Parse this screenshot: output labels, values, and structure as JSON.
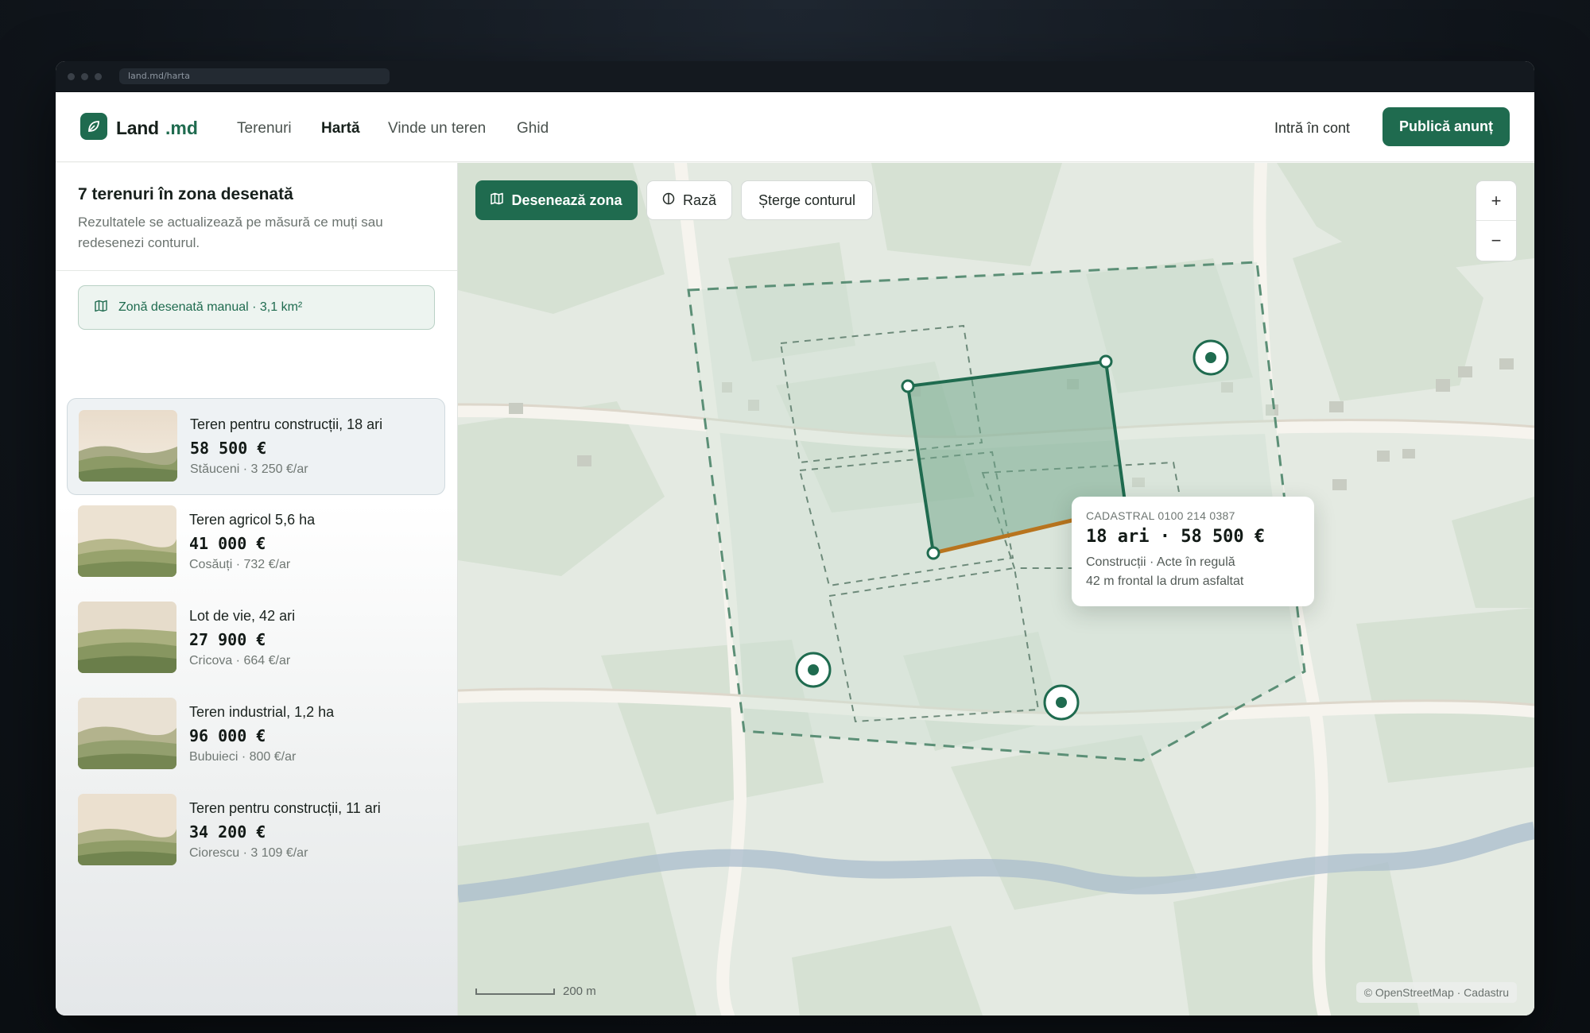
{
  "browser": {
    "url": "land.md/harta"
  },
  "brand": {
    "name": "Land",
    "tld": ".md",
    "accent": "#1f6b4f"
  },
  "nav": {
    "items": [
      {
        "label": "Terenuri",
        "active": false
      },
      {
        "label": "Hartă",
        "active": true
      },
      {
        "label": "Vinde un teren",
        "active": false
      },
      {
        "label": "Ghid",
        "active": false
      }
    ],
    "login": "Intră în cont",
    "publish": "Publică anunț"
  },
  "sidebar": {
    "title": "7 terenuri în zona desenată",
    "subtitle": "Rezultatele se actualizează pe măsură ce muți sau redesenezi conturul.",
    "zone_chip": "Zonă desenată manual · 3,1 km²",
    "listings": [
      {
        "title": "Teren pentru construcții, 18 ari",
        "price": "58 500 €",
        "meta": "Stăuceni · 3 250 €/ar",
        "selected": true
      },
      {
        "title": "Teren agricol 5,6 ha",
        "price": "41 000 €",
        "meta": "Cosăuți · 732 €/ar",
        "selected": false
      },
      {
        "title": "Lot de vie, 42 ari",
        "price": "27 900 €",
        "meta": "Cricova · 664 €/ar",
        "selected": false
      },
      {
        "title": "Teren industrial, 1,2 ha",
        "price": "96 000 €",
        "meta": "Bubuieci · 800 €/ar",
        "selected": false
      },
      {
        "title": "Teren pentru construcții, 11 ari",
        "price": "34 200 €",
        "meta": "Ciorescu · 3 109 €/ar",
        "selected": false
      }
    ]
  },
  "map": {
    "tools": {
      "draw": "Desenează zona",
      "radius": "Rază",
      "clear": "Șterge conturul"
    },
    "zoom": {
      "in": "+",
      "out": "−"
    },
    "popup": {
      "cadastral": "CADASTRAL 0100 214 0387",
      "main": "18 ari · 58 500 €",
      "line1": "Construcții · Acte în regulă",
      "line2": "42 m frontal la drum asfaltat"
    },
    "scale": "200 m",
    "attribution": "© OpenStreetMap · Cadastru"
  }
}
